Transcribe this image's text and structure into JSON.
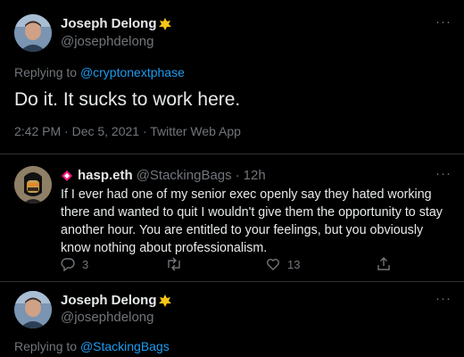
{
  "tweet_top": {
    "name": "Joseph Delong",
    "handle": "@josephdelong",
    "replying_prefix": "Replying to",
    "replying_to": "@cryptonextphase",
    "text": "Do it. It sucks to work here.",
    "meta": "2:42 PM · Dec 5, 2021 · Twitter Web App"
  },
  "reply": {
    "name": "hasp.eth",
    "handle": "@StackingBags",
    "separator": "·",
    "time": "12h",
    "text": "If I ever had one of my senior exec openly say they hated working there and wanted to quit I wouldn't give them the opportunity to stay another hour.  You  are entitled to your feelings, but you obviously know nothing about professionalism.",
    "reply_count": "3",
    "like_count": "13"
  },
  "tweet_bottom": {
    "name": "Joseph Delong",
    "handle": "@josephdelong",
    "replying_prefix": "Replying to",
    "replying_to": "@StackingBags"
  },
  "colors": {
    "background": "#000000",
    "text": "#e7e9ea",
    "muted": "#71767b",
    "link": "#1d9bf0",
    "divider": "#2f3336",
    "badge": "#f5c518"
  },
  "icons": {
    "more": "more-dots-icon",
    "reply": "reply-icon",
    "retweet": "retweet-icon",
    "like": "heart-icon",
    "share": "share-icon",
    "badge": "sushi-badge-icon",
    "nft": "nft-diamond-icon"
  }
}
